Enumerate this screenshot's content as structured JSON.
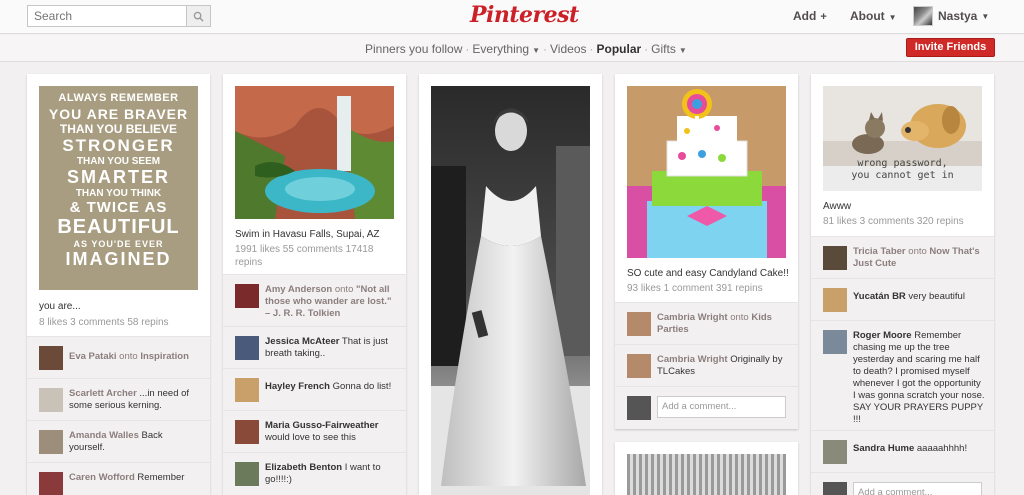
{
  "header": {
    "search_placeholder": "Search",
    "logo": "Pinterest",
    "add_label": "Add",
    "about_label": "About",
    "user_name": "Nastya"
  },
  "subnav": {
    "pinners": "Pinners you follow",
    "everything": "Everything",
    "videos": "Videos",
    "popular": "Popular",
    "gifts": "Gifts",
    "invite": "Invite Friends"
  },
  "pins": {
    "p1": {
      "image_lines": [
        "ALWAYS REMEMBER",
        "YOU ARE BRAVER",
        "THAN YOU BELIEVE",
        "STRONGER",
        "THAN YOU SEEM",
        "SMARTER",
        "THAN YOU THINK",
        "& TWICE AS",
        "BEAUTIFUL",
        "AS YOU'DE EVER",
        "IMAGINED"
      ],
      "desc": "you are...",
      "stats": "8 likes  3 comments  58 repins",
      "comments": [
        {
          "name": "Eva Pataki",
          "onto": " onto ",
          "board": "Inspiration",
          "text": ""
        },
        {
          "name": "Scarlett Archer",
          "text": " ...in need of some serious kerning."
        },
        {
          "name": "Amanda Walles",
          "text": " Back yourself."
        },
        {
          "name": "Caren Wofford",
          "text": " Remember"
        }
      ]
    },
    "p2": {
      "desc": "Swim in Havasu Falls, Supai, AZ",
      "stats": "1991 likes  55 comments  17418 repins",
      "comments": [
        {
          "name": "Amy Anderson",
          "onto": " onto ",
          "board": "\"Not all those who wander are lost.\" – J. R. R. Tolkien",
          "text": ""
        },
        {
          "name": "Jessica McAteer",
          "text": " That is just breath taking.."
        },
        {
          "name": "Hayley French",
          "text": " Gonna do list!"
        },
        {
          "name": "Maria Gusso-Fairweather",
          "text": " would love to see this"
        },
        {
          "name": "Elizabeth Benton",
          "text": " I want to go!!!!:)"
        }
      ]
    },
    "p4": {
      "desc": "SO cute and easy Candyland Cake!!",
      "stats": "93 likes  1 comment  391 repins",
      "comments": [
        {
          "name": "Cambria Wright",
          "onto": " onto ",
          "board": "Kids Parties",
          "text": ""
        },
        {
          "name": "Cambria Wright",
          "text": " Originally by TLCakes"
        }
      ],
      "add_comment": "Add a comment..."
    },
    "p5": {
      "image_caption": [
        "wrong password,",
        "you cannot get in"
      ],
      "desc": "Awww",
      "stats": "81 likes  3 comments  320 repins",
      "comments": [
        {
          "name": "Tricia Taber",
          "onto": " onto ",
          "board": "Now That's Just Cute",
          "text": ""
        },
        {
          "name": "Yucatán BR",
          "text": " very beautiful"
        },
        {
          "name": "Roger Moore",
          "text": " Remember chasing me up the tree yesterday and scaring me half to death? I promised myself whenever I got the opportunity I was gonna scratch your nose. SAY YOUR PRAYERS PUPPY !!!"
        },
        {
          "name": "Sandra Hume",
          "text": " aaaaahhhh!"
        }
      ],
      "add_comment": "Add a comment..."
    }
  },
  "colors": {
    "brand": "#cb2027",
    "background": "#f2f0f0",
    "name_text": "#8c7e7e"
  }
}
